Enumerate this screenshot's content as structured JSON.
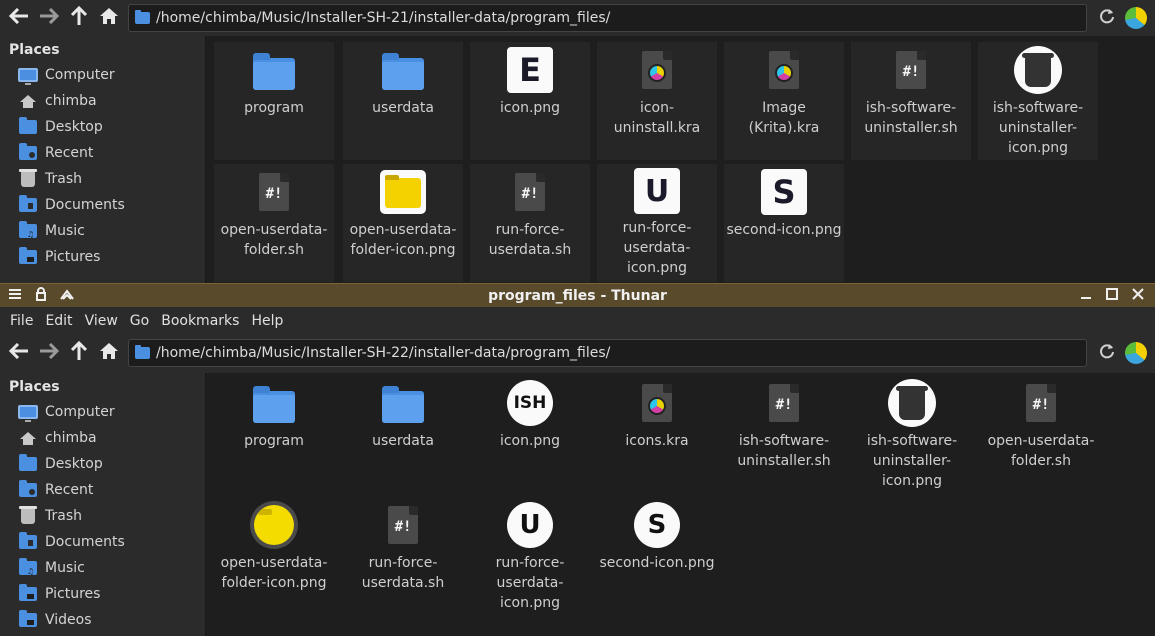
{
  "window1": {
    "location": "/home/chimba/Music/Installer-SH-21/installer-data/program_files/",
    "places_header": "Places",
    "places": [
      "Computer",
      "chimba",
      "Desktop",
      "Recent",
      "Trash",
      "Documents",
      "Music",
      "Pictures"
    ],
    "files": [
      {
        "name": "program",
        "icon": "folder-icon"
      },
      {
        "name": "userdata",
        "icon": "folder-icon"
      },
      {
        "name": "icon.png",
        "icon": "image-e-icon"
      },
      {
        "name": "icon-uninstall.kra",
        "icon": "krita-icon"
      },
      {
        "name": "Image (Krita).kra",
        "icon": "krita-icon"
      },
      {
        "name": "ish-software-uninstaller.sh",
        "icon": "script-icon"
      },
      {
        "name": "ish-software-uninstaller-icon.png",
        "icon": "trash-image-icon"
      },
      {
        "name": "open-userdata-folder.sh",
        "icon": "script-icon"
      },
      {
        "name": "open-userdata-folder-icon.png",
        "icon": "yellow-folder-image-icon"
      },
      {
        "name": "run-force-userdata.sh",
        "icon": "script-icon"
      },
      {
        "name": "run-force-userdata-icon.png",
        "icon": "image-u-icon"
      },
      {
        "name": "second-icon.png",
        "icon": "image-s-icon"
      }
    ]
  },
  "window2": {
    "title": "program_files - Thunar",
    "menu": [
      "File",
      "Edit",
      "View",
      "Go",
      "Bookmarks",
      "Help"
    ],
    "location": "/home/chimba/Music/Installer-SH-22/installer-data/program_files/",
    "places_header": "Places",
    "places": [
      "Computer",
      "chimba",
      "Desktop",
      "Recent",
      "Trash",
      "Documents",
      "Music",
      "Pictures",
      "Videos"
    ],
    "files": [
      {
        "name": "program",
        "icon": "folder-icon"
      },
      {
        "name": "userdata",
        "icon": "folder-icon"
      },
      {
        "name": "icon.png",
        "icon": "image-ish-icon",
        "text": "ISH"
      },
      {
        "name": "icons.kra",
        "icon": "krita-icon"
      },
      {
        "name": "ish-software-uninstaller.sh",
        "icon": "script-icon"
      },
      {
        "name": "ish-software-uninstaller-icon.png",
        "icon": "trash-image-icon"
      },
      {
        "name": "open-userdata-folder.sh",
        "icon": "script-icon"
      },
      {
        "name": "open-userdata-folder-icon.png",
        "icon": "yellow-circle-image-icon"
      },
      {
        "name": "run-force-userdata.sh",
        "icon": "script-icon"
      },
      {
        "name": "run-force-userdata-icon.png",
        "icon": "image-u-icon"
      },
      {
        "name": "second-icon.png",
        "icon": "image-s-icon"
      }
    ]
  },
  "glyphs": {
    "script_hash": "#!",
    "letter_e": "E",
    "letter_u": "U",
    "letter_s": "S"
  },
  "colors": {
    "titlebar": "#5a4a2c",
    "folder": "#4a90e2",
    "background": "#1e1e1e",
    "sidebar": "#2b2b2b"
  }
}
